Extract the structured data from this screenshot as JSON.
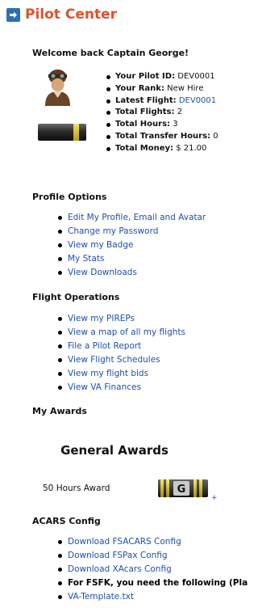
{
  "header": {
    "title": "Pilot Center",
    "icon": "arrow-right-icon"
  },
  "welcome": "Welcome back Captain George!",
  "pilot": {
    "avatar_icon": "pilot-avatar",
    "rank_badge_icon": "rank-stripes-badge",
    "stats": [
      {
        "label": "Your Pilot ID:",
        "value": "DEV0001",
        "is_link": false
      },
      {
        "label": "Your Rank:",
        "value": "New Hire",
        "is_link": false
      },
      {
        "label": "Latest Flight:",
        "value": "DEV0001",
        "is_link": true
      },
      {
        "label": "Total Flights:",
        "value": "2",
        "is_link": false
      },
      {
        "label": "Total Hours:",
        "value": "3",
        "is_link": false
      },
      {
        "label": "Total Transfer Hours:",
        "value": "0",
        "is_link": false
      },
      {
        "label": "Total Money:",
        "value": "$ 21.00",
        "is_link": false
      }
    ]
  },
  "profile_options": {
    "title": "Profile Options",
    "items": [
      "Edit My Profile, Email and Avatar",
      "Change my Password",
      "View my Badge",
      "My Stats",
      "View Downloads"
    ]
  },
  "flight_operations": {
    "title": "Flight Operations",
    "items": [
      "View my PIREPs",
      "View a map of all my flights",
      "File a Pilot Report",
      "View Flight Schedules",
      "View my flight bids",
      "View VA Finances"
    ]
  },
  "my_awards": {
    "title": "My Awards",
    "heading": "General Awards",
    "award_name": "50 Hours Award",
    "award_badge_icon": "award-badge-g",
    "award_badge_text": "G",
    "plus_label": "+"
  },
  "acars_config": {
    "title": "ACARS Config",
    "items": [
      {
        "text": "Download FSACARS Config",
        "link": true
      },
      {
        "text": "Download FSPax Config",
        "link": true
      },
      {
        "text": "Download XAcars Config",
        "link": true
      },
      {
        "text": "For FSFK, you need the following (Pla",
        "link": false
      },
      {
        "text": "VA-Template.txt",
        "link": true
      }
    ]
  },
  "colors": {
    "title": "#e0522a",
    "link": "#1d4fb0",
    "icon_bg": "#2d6fb6"
  }
}
